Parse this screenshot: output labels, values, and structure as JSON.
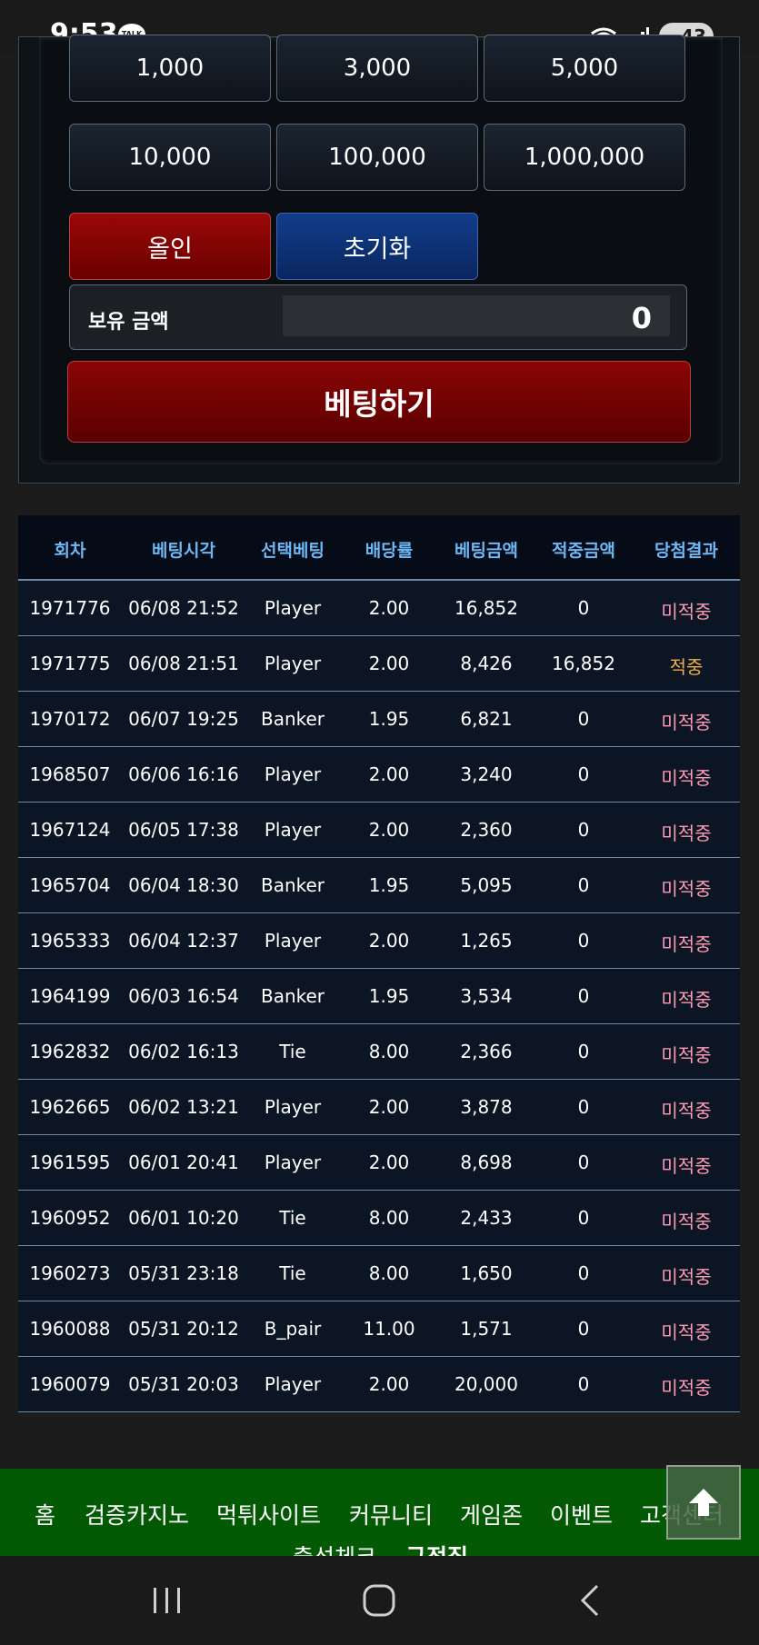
{
  "status_bar": {
    "time": "9:53",
    "talk_badge": "TALK",
    "battery": "43"
  },
  "chips": [
    "1,000",
    "3,000",
    "5,000",
    "10,000",
    "100,000",
    "1,000,000"
  ],
  "buttons": {
    "all_in": "올인",
    "reset": "초기화",
    "bet": "베팅하기"
  },
  "balance": {
    "label": "보유 금액",
    "value": "0"
  },
  "table": {
    "headers": [
      "회차",
      "베팅시각",
      "선택베팅",
      "배당률",
      "베팅금액",
      "적중금액",
      "당첨결과"
    ],
    "rows": [
      [
        "1971776",
        "06/08 21:52",
        "Player",
        "2.00",
        "16,852",
        "0",
        "미적중"
      ],
      [
        "1971775",
        "06/08 21:51",
        "Player",
        "2.00",
        "8,426",
        "16,852",
        "적중"
      ],
      [
        "1970172",
        "06/07 19:25",
        "Banker",
        "1.95",
        "6,821",
        "0",
        "미적중"
      ],
      [
        "1968507",
        "06/06 16:16",
        "Player",
        "2.00",
        "3,240",
        "0",
        "미적중"
      ],
      [
        "1967124",
        "06/05 17:38",
        "Player",
        "2.00",
        "2,360",
        "0",
        "미적중"
      ],
      [
        "1965704",
        "06/04 18:30",
        "Banker",
        "1.95",
        "5,095",
        "0",
        "미적중"
      ],
      [
        "1965333",
        "06/04 12:37",
        "Player",
        "2.00",
        "1,265",
        "0",
        "미적중"
      ],
      [
        "1964199",
        "06/03 16:54",
        "Banker",
        "1.95",
        "3,534",
        "0",
        "미적중"
      ],
      [
        "1962832",
        "06/02 16:13",
        "Tie",
        "8.00",
        "2,366",
        "0",
        "미적중"
      ],
      [
        "1962665",
        "06/02 13:21",
        "Player",
        "2.00",
        "3,878",
        "0",
        "미적중"
      ],
      [
        "1961595",
        "06/01 20:41",
        "Player",
        "2.00",
        "8,698",
        "0",
        "미적중"
      ],
      [
        "1960952",
        "06/01 10:20",
        "Tie",
        "8.00",
        "2,433",
        "0",
        "미적중"
      ],
      [
        "1960273",
        "05/31 23:18",
        "Tie",
        "8.00",
        "1,650",
        "0",
        "미적중"
      ],
      [
        "1960088",
        "05/31 20:12",
        "B_pair",
        "11.00",
        "1,571",
        "0",
        "미적중"
      ],
      [
        "1960079",
        "05/31 20:03",
        "Player",
        "2.00",
        "20,000",
        "0",
        "미적중"
      ]
    ]
  },
  "bottom_nav": {
    "items": [
      "홈",
      "검증카지노",
      "먹튀사이트",
      "커뮤니티",
      "게임존",
      "이벤트",
      "고객센터"
    ],
    "items_row2": [
      "출석체크",
      "규정집"
    ]
  },
  "colors": {
    "miss": "#ff9bb3",
    "hit": "#f0b040",
    "header_text": "#6fb6f4",
    "nav_bg": "#045a04"
  }
}
